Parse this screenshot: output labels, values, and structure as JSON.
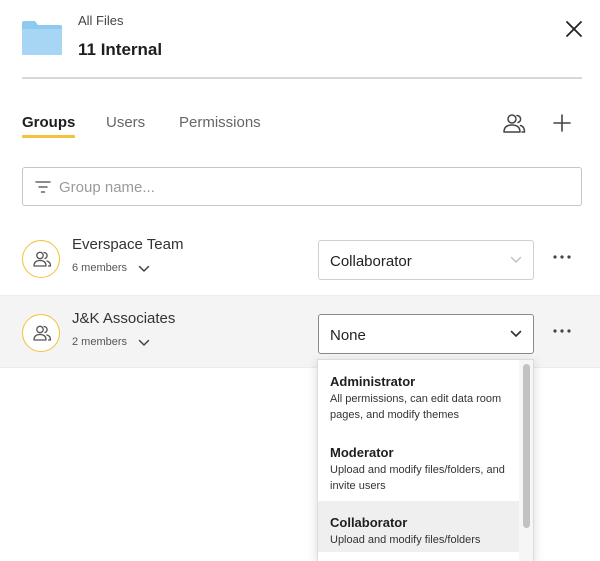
{
  "header": {
    "breadcrumb": "All Files",
    "title": "11 Internal",
    "folder_color": "#8ec9f0"
  },
  "tabs": [
    {
      "label": "Groups",
      "active": true
    },
    {
      "label": "Users",
      "active": false
    },
    {
      "label": "Permissions",
      "active": false
    }
  ],
  "accent_color": "#f5c03a",
  "search": {
    "placeholder": "Group name...",
    "value": ""
  },
  "groups": [
    {
      "name": "Everspace Team",
      "members": "6 members",
      "role": "Collaborator"
    },
    {
      "name": "J&K Associates",
      "members": "2 members",
      "role": "None"
    }
  ],
  "dropdown": {
    "options": [
      {
        "title": "Administrator",
        "description": "All permissions, can edit data room pages, and modify themes"
      },
      {
        "title": "Moderator",
        "description": "Upload and modify files/folders, and invite users"
      },
      {
        "title": "Collaborator",
        "description": "Upload and modify files/folders"
      }
    ]
  },
  "icons": {
    "folder": "folder-icon",
    "close": "close-icon",
    "manage_groups": "users-icon",
    "add": "plus-icon",
    "filter": "filter-icon",
    "group_avatar": "group-icon",
    "chevron": "chevron-down-icon",
    "more": "more-horizontal-icon"
  }
}
